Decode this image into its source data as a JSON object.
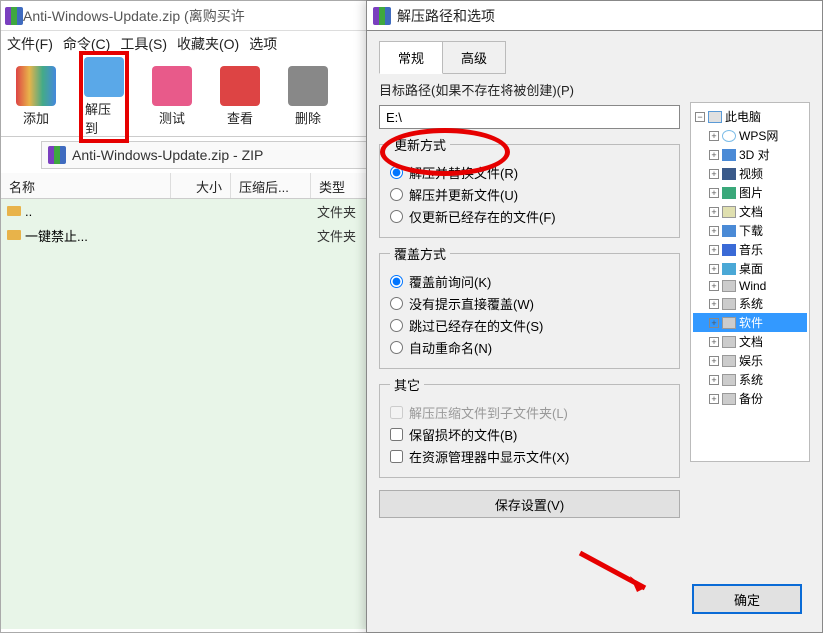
{
  "main": {
    "title": "Anti-Windows-Update.zip (离购买许",
    "menu": [
      "文件(F)",
      "命令(C)",
      "工具(S)",
      "收藏夹(O)",
      "选项"
    ],
    "toolbar": [
      {
        "label": "添加",
        "icon": "add"
      },
      {
        "label": "解压到",
        "icon": "extract",
        "highlighted": true
      },
      {
        "label": "测试",
        "icon": "test"
      },
      {
        "label": "查看",
        "icon": "view"
      },
      {
        "label": "删除",
        "icon": "delete"
      }
    ],
    "path_text": "Anti-Windows-Update.zip - ZIP",
    "columns": [
      "名称",
      "大小",
      "压缩后...",
      "类型"
    ],
    "rows": [
      {
        "name": "..",
        "type": "文件夹"
      },
      {
        "name": "一键禁止...",
        "type": "文件夹"
      }
    ]
  },
  "dialog": {
    "title": "解压路径和选项",
    "tabs": [
      "常规",
      "高级"
    ],
    "active_tab": 0,
    "dest_label": "目标路径(如果不存在将被创建)(P)",
    "dest_value": "E:\\",
    "update_legend": "更新方式",
    "update_opts": [
      {
        "label": "解压并替换文件(R)",
        "checked": true
      },
      {
        "label": "解压并更新文件(U)",
        "checked": false
      },
      {
        "label": "仅更新已经存在的文件(F)",
        "checked": false
      }
    ],
    "overwrite_legend": "覆盖方式",
    "overwrite_opts": [
      {
        "label": "覆盖前询问(K)",
        "checked": true
      },
      {
        "label": "没有提示直接覆盖(W)",
        "checked": false
      },
      {
        "label": "跳过已经存在的文件(S)",
        "checked": false
      },
      {
        "label": "自动重命名(N)",
        "checked": false
      }
    ],
    "misc_legend": "其它",
    "misc_opts": [
      {
        "label": "解压压缩文件到子文件夹(L)",
        "checked": false,
        "disabled": true
      },
      {
        "label": "保留损坏的文件(B)",
        "checked": false
      },
      {
        "label": "在资源管理器中显示文件(X)",
        "checked": false
      }
    ],
    "save_settings": "保存设置(V)",
    "tree_root": "此电脑",
    "tree": [
      {
        "label": "WPS网",
        "icon": "wps"
      },
      {
        "label": "3D 对",
        "icon": "d3"
      },
      {
        "label": "视频",
        "icon": "video"
      },
      {
        "label": "图片",
        "icon": "pic"
      },
      {
        "label": "文档",
        "icon": "doc"
      },
      {
        "label": "下载",
        "icon": "dl"
      },
      {
        "label": "音乐",
        "icon": "music"
      },
      {
        "label": "桌面",
        "icon": "desk"
      },
      {
        "label": "Wind",
        "icon": "drive"
      },
      {
        "label": "系统",
        "icon": "drive"
      },
      {
        "label": "软件",
        "icon": "drive",
        "selected": true
      },
      {
        "label": "文档",
        "icon": "drive"
      },
      {
        "label": "娱乐",
        "icon": "drive"
      },
      {
        "label": "系统",
        "icon": "drive"
      },
      {
        "label": "备份",
        "icon": "drive"
      }
    ],
    "ok": "确定"
  }
}
